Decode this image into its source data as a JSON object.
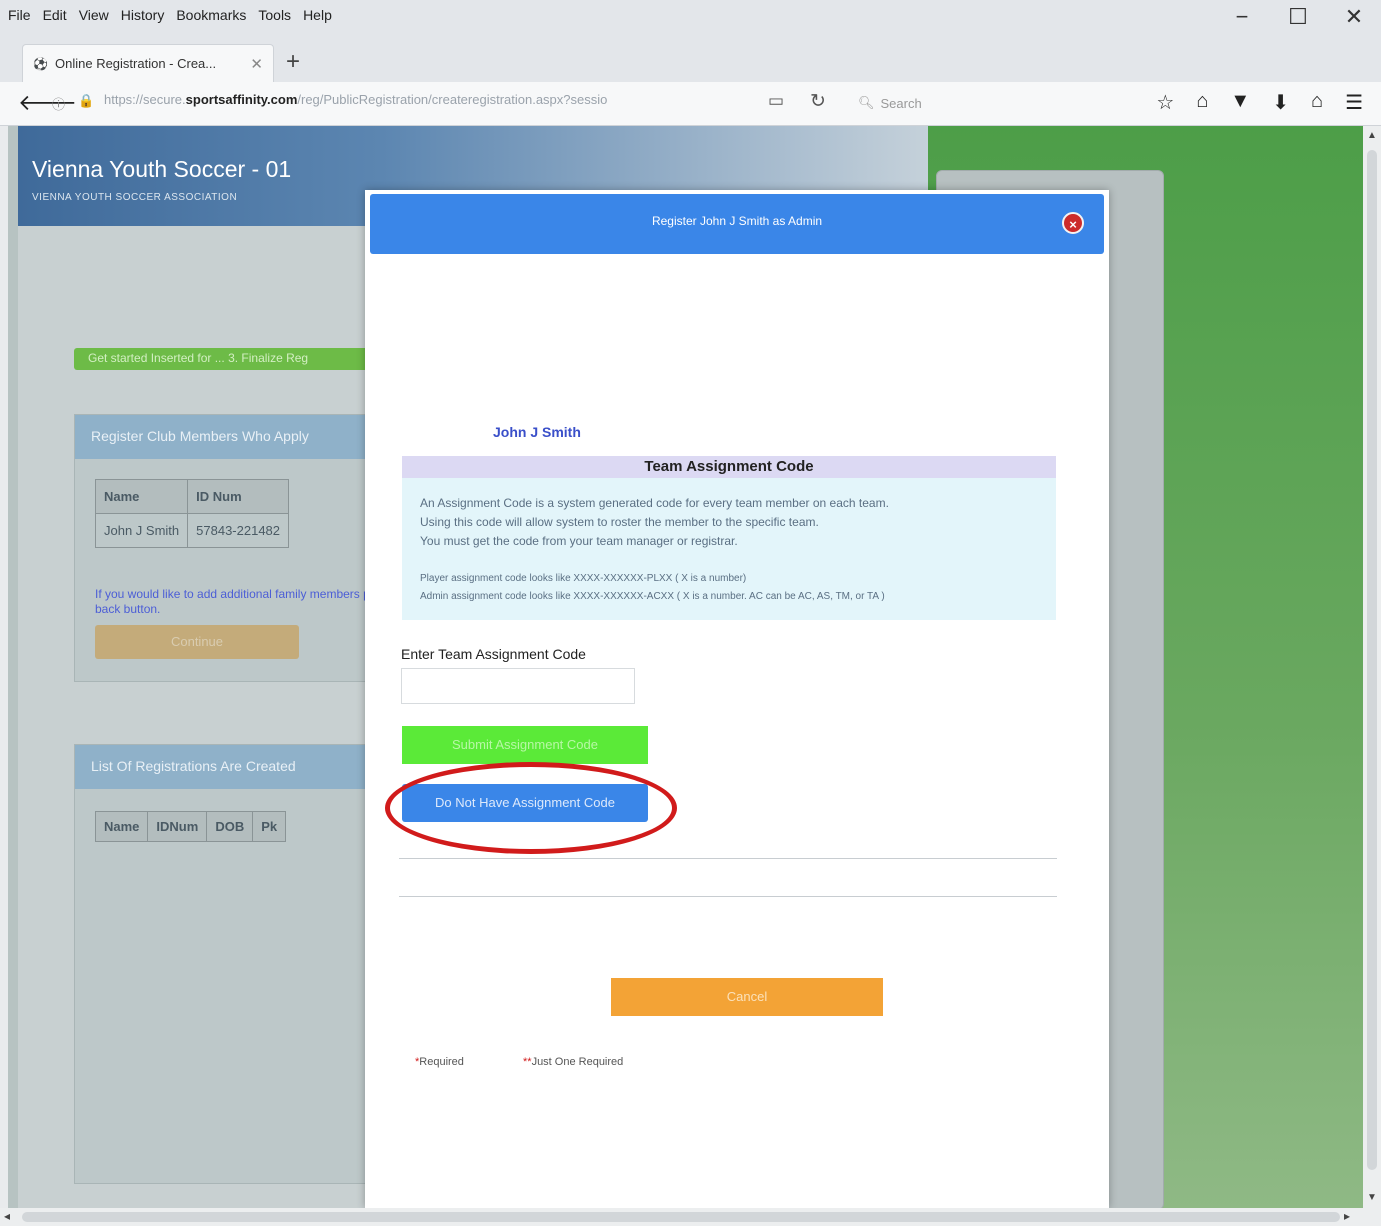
{
  "menu": {
    "file": "File",
    "edit": "Edit",
    "view": "View",
    "history": "History",
    "bookmarks": "Bookmarks",
    "tools": "Tools",
    "help": "Help"
  },
  "window_controls": {
    "minimize": "−",
    "maximize": "☐",
    "close": "✕"
  },
  "tab": {
    "title": "Online Registration - Crea...",
    "close": "✕",
    "new": "+"
  },
  "nav": {
    "url_prefix": "https://secure.",
    "url_domain": "sportsaffinity.com",
    "url_suffix": "/reg/PublicRegistration/createregistration.aspx?sessio",
    "search_placeholder": "Search"
  },
  "site": {
    "title": "Vienna Youth Soccer - 01",
    "subtitle": "VIENNA YOUTH SOCCER ASSOCIATION",
    "progress": "Get started Inserted for ... 3. Finalize Reg",
    "block1_header": "Register Club Members Who Apply",
    "table1_headers": [
      "Name",
      "ID Num"
    ],
    "table1_row": [
      "John J Smith",
      "57843-221482"
    ],
    "note": "If you would like to add additional family members please click the back button.",
    "continue_btn": "Continue",
    "block2_header": "List Of Registrations Are Created",
    "table2_headers": [
      "Name",
      "IDNum",
      "DOB",
      "Pk"
    ]
  },
  "modal": {
    "title": "Register John J Smith as Admin",
    "close": "×",
    "player_name": "John J Smith",
    "info_title": "Team Assignment Code",
    "info_line1": "An Assignment Code is a system generated code for every team member on each team.",
    "info_line2": "Using this code will allow system to roster the member to the specific team.",
    "info_line3": "You must get the code from your team manager or registrar.",
    "info_line4": "Player assignment code looks like XXXX-XXXXXX-PLXX ( X is a number)",
    "info_line5": "Admin assignment code looks like XXXX-XXXXXX-ACXX ( X is a number. AC can be AC, AS, TM, or TA )",
    "code_label": "Enter Team Assignment Code",
    "code_value": "",
    "submit_btn": "Submit Assignment Code",
    "nocode_btn": "Do Not Have Assignment Code",
    "cancel_btn": "Cancel",
    "legend_required": "Required",
    "legend_just_one": "Just One Required"
  },
  "colors": {
    "modal_header": "#3a86e8",
    "submit": "#5bea38",
    "cancel": "#f3a336",
    "highlight_circle": "#d11b1b"
  }
}
